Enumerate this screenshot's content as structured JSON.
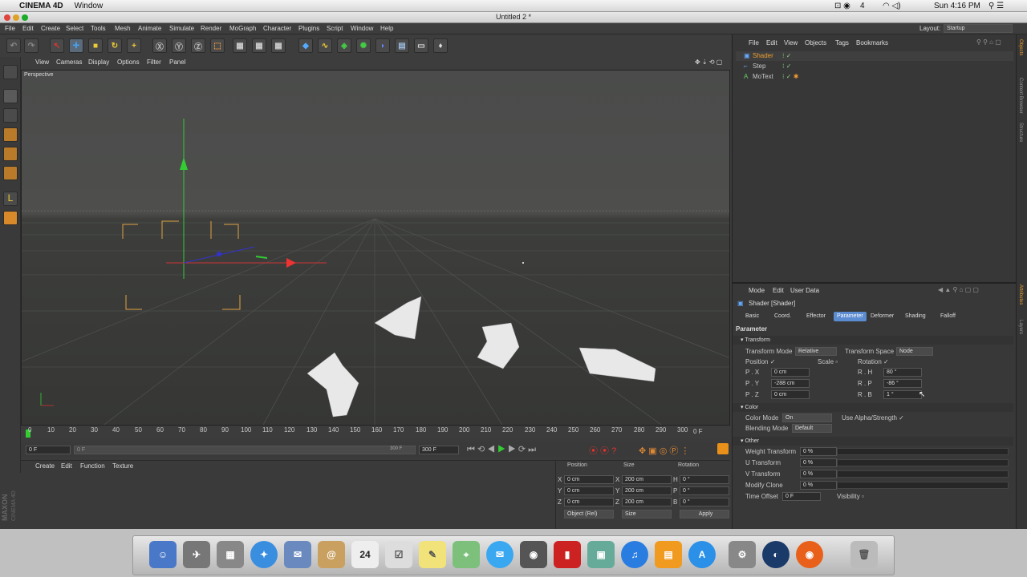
{
  "mac": {
    "app": "CINEMA 4D",
    "menu": "Window",
    "battery": "4",
    "time": "Sun 4:16 PM"
  },
  "window": {
    "title": "Untitled 2 *",
    "layout_label": "Layout:",
    "layout_value": "Startup"
  },
  "menus": [
    "File",
    "Edit",
    "Create",
    "Select",
    "Tools",
    "Mesh",
    "Animate",
    "Simulate",
    "Render",
    "MoGraph",
    "Character",
    "Plugins",
    "Script",
    "Window",
    "Help"
  ],
  "viewport": {
    "menu": [
      "View",
      "Cameras",
      "Display",
      "Options",
      "Filter",
      "Panel"
    ],
    "label": "Perspective"
  },
  "timeline": {
    "ticks": [
      "0",
      "10",
      "20",
      "30",
      "40",
      "50",
      "60",
      "70",
      "80",
      "90",
      "100",
      "110",
      "120",
      "130",
      "140",
      "150",
      "160",
      "170",
      "180",
      "190",
      "200",
      "210",
      "220",
      "230",
      "240",
      "250",
      "260",
      "270",
      "280",
      "290",
      "300"
    ],
    "end_label": "0 F",
    "current": "0 F",
    "start": "0 F",
    "max": "300 F",
    "max2": "300 F"
  },
  "materials": {
    "menu": [
      "Create",
      "Edit",
      "Function",
      "Texture"
    ],
    "brand1": "MAXON",
    "brand2": "CINEMA 4D"
  },
  "coords": {
    "headers": [
      "Position",
      "Size",
      "Rotation"
    ],
    "rows": [
      {
        "a": "X",
        "p": "0 cm",
        "s": "200 cm",
        "r": "H",
        "rv": "0 °"
      },
      {
        "a": "Y",
        "p": "0 cm",
        "s": "200 cm",
        "r": "P",
        "rv": "0 °"
      },
      {
        "a": "Z",
        "p": "0 cm",
        "s": "200 cm",
        "r": "B",
        "rv": "0 °"
      }
    ],
    "mode": "Object (Rel)",
    "size_mode": "Size",
    "apply": "Apply"
  },
  "objects": {
    "menu": [
      "File",
      "Edit",
      "View",
      "Objects",
      "Tags",
      "Bookmarks"
    ],
    "items": [
      "Shader",
      "Step",
      "MoText"
    ]
  },
  "attributes": {
    "menu": [
      "Mode",
      "Edit",
      "User Data"
    ],
    "title": "Shader [Shader]",
    "tabs": [
      "Basic",
      "Coord.",
      "Effector",
      "Parameter",
      "Deformer",
      "Shading",
      "Falloff"
    ],
    "active_tab": "Parameter",
    "section": "Parameter",
    "transform": {
      "header": "Transform",
      "mode_label": "Transform Mode",
      "mode_val": "Relative",
      "space_label": "Transform Space",
      "space_val": "Node",
      "position": "Position",
      "scale": "Scale",
      "rotation": "Rotation",
      "px_label": "P . X",
      "px": "0 cm",
      "py_label": "P . Y",
      "py": "-288 cm",
      "pz_label": "P . Z",
      "pz": "0 cm",
      "rh_label": "R . H",
      "rh": "80 °",
      "rp_label": "R . P",
      "rp": "-86 °",
      "rb_label": "R . B",
      "rb": "1 °"
    },
    "color": {
      "header": "Color",
      "mode_label": "Color Mode",
      "mode_val": "On",
      "alpha": "Use Alpha/Strength",
      "blend_label": "Blending Mode",
      "blend_val": "Default"
    },
    "other": {
      "header": "Other",
      "weight": "Weight Transform",
      "weight_v": "0 %",
      "u": "U Transform",
      "u_v": "0 %",
      "v": "V Transform",
      "v_v": "0 %",
      "clone": "Modify Clone",
      "clone_v": "0 %",
      "offset": "Time Offset",
      "offset_v": "0 F",
      "visibility": "Visibility"
    }
  },
  "right_tabs": [
    "Objects",
    "Content Browser",
    "Structure",
    "Attributes",
    "Layers"
  ],
  "dock": {
    "date": "24"
  }
}
